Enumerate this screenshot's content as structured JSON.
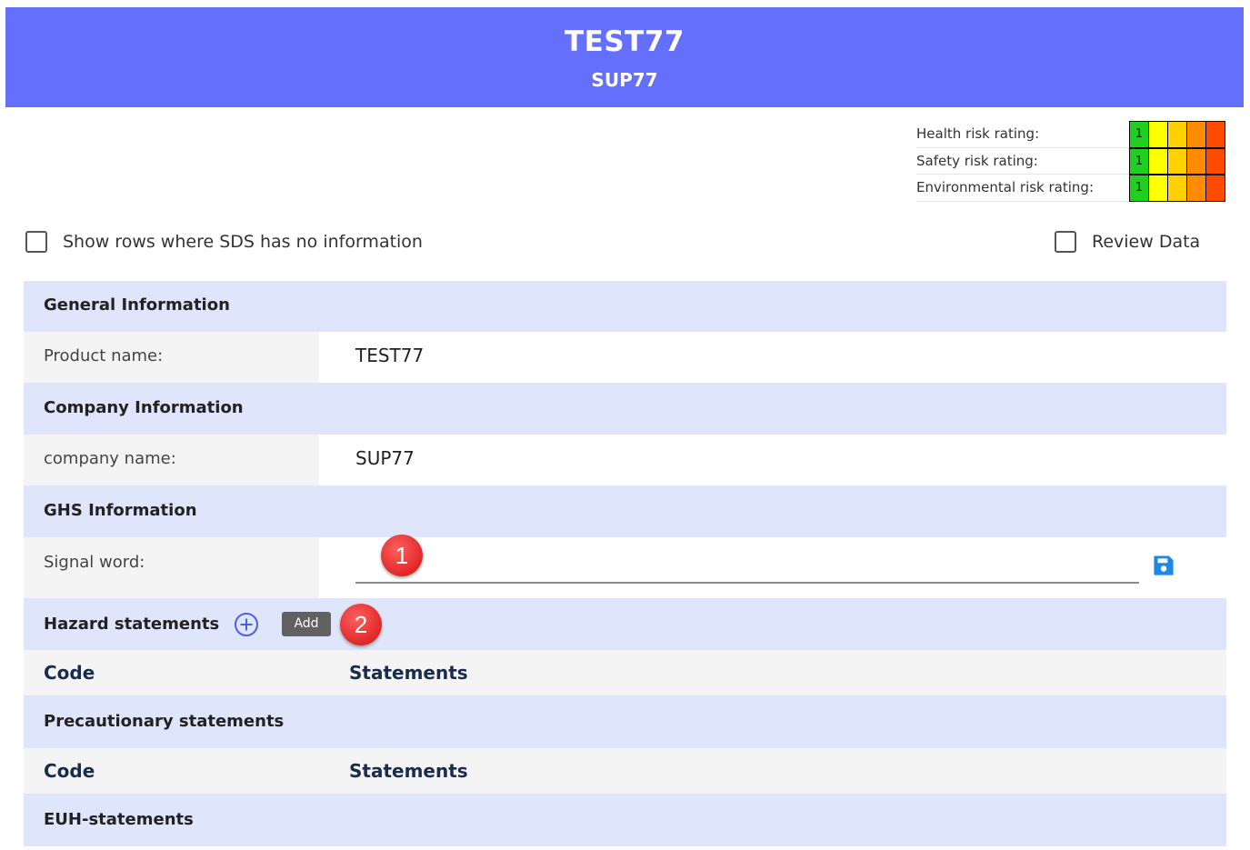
{
  "header": {
    "title": "TEST77",
    "subtitle": "SUP77",
    "color": "#646ffb"
  },
  "ratings": [
    {
      "label": "Health risk rating:",
      "value": "1"
    },
    {
      "label": "Safety risk rating:",
      "value": "1"
    },
    {
      "label": "Environmental risk rating:",
      "value": "1"
    }
  ],
  "rating_scale_colors": [
    "#1fd01f",
    "#ffff00",
    "#ffd100",
    "#ff8c00",
    "#ff4a00"
  ],
  "filters": {
    "show_empty_label": "Show rows where SDS has no information",
    "show_empty_checked": false,
    "review_label": "Review Data",
    "review_checked": false
  },
  "sections": {
    "general": {
      "title": "General Information",
      "product_label": "Product name:",
      "product_value": "TEST77"
    },
    "company": {
      "title": "Company Information",
      "company_label": "company name:",
      "company_value": "SUP77"
    },
    "ghs": {
      "title": "GHS Information",
      "signal_label": "Signal word:",
      "signal_value": ""
    },
    "hazard": {
      "title": "Hazard statements",
      "add_label": "Add",
      "col_code": "Code",
      "col_statements": "Statements"
    },
    "precautionary": {
      "title": "Precautionary statements",
      "col_code": "Code",
      "col_statements": "Statements"
    },
    "euh": {
      "title": "EUH-statements"
    }
  },
  "annotations": {
    "badge1": "1",
    "badge2": "2"
  },
  "icons": [
    "save-icon",
    "add-circle-icon"
  ]
}
